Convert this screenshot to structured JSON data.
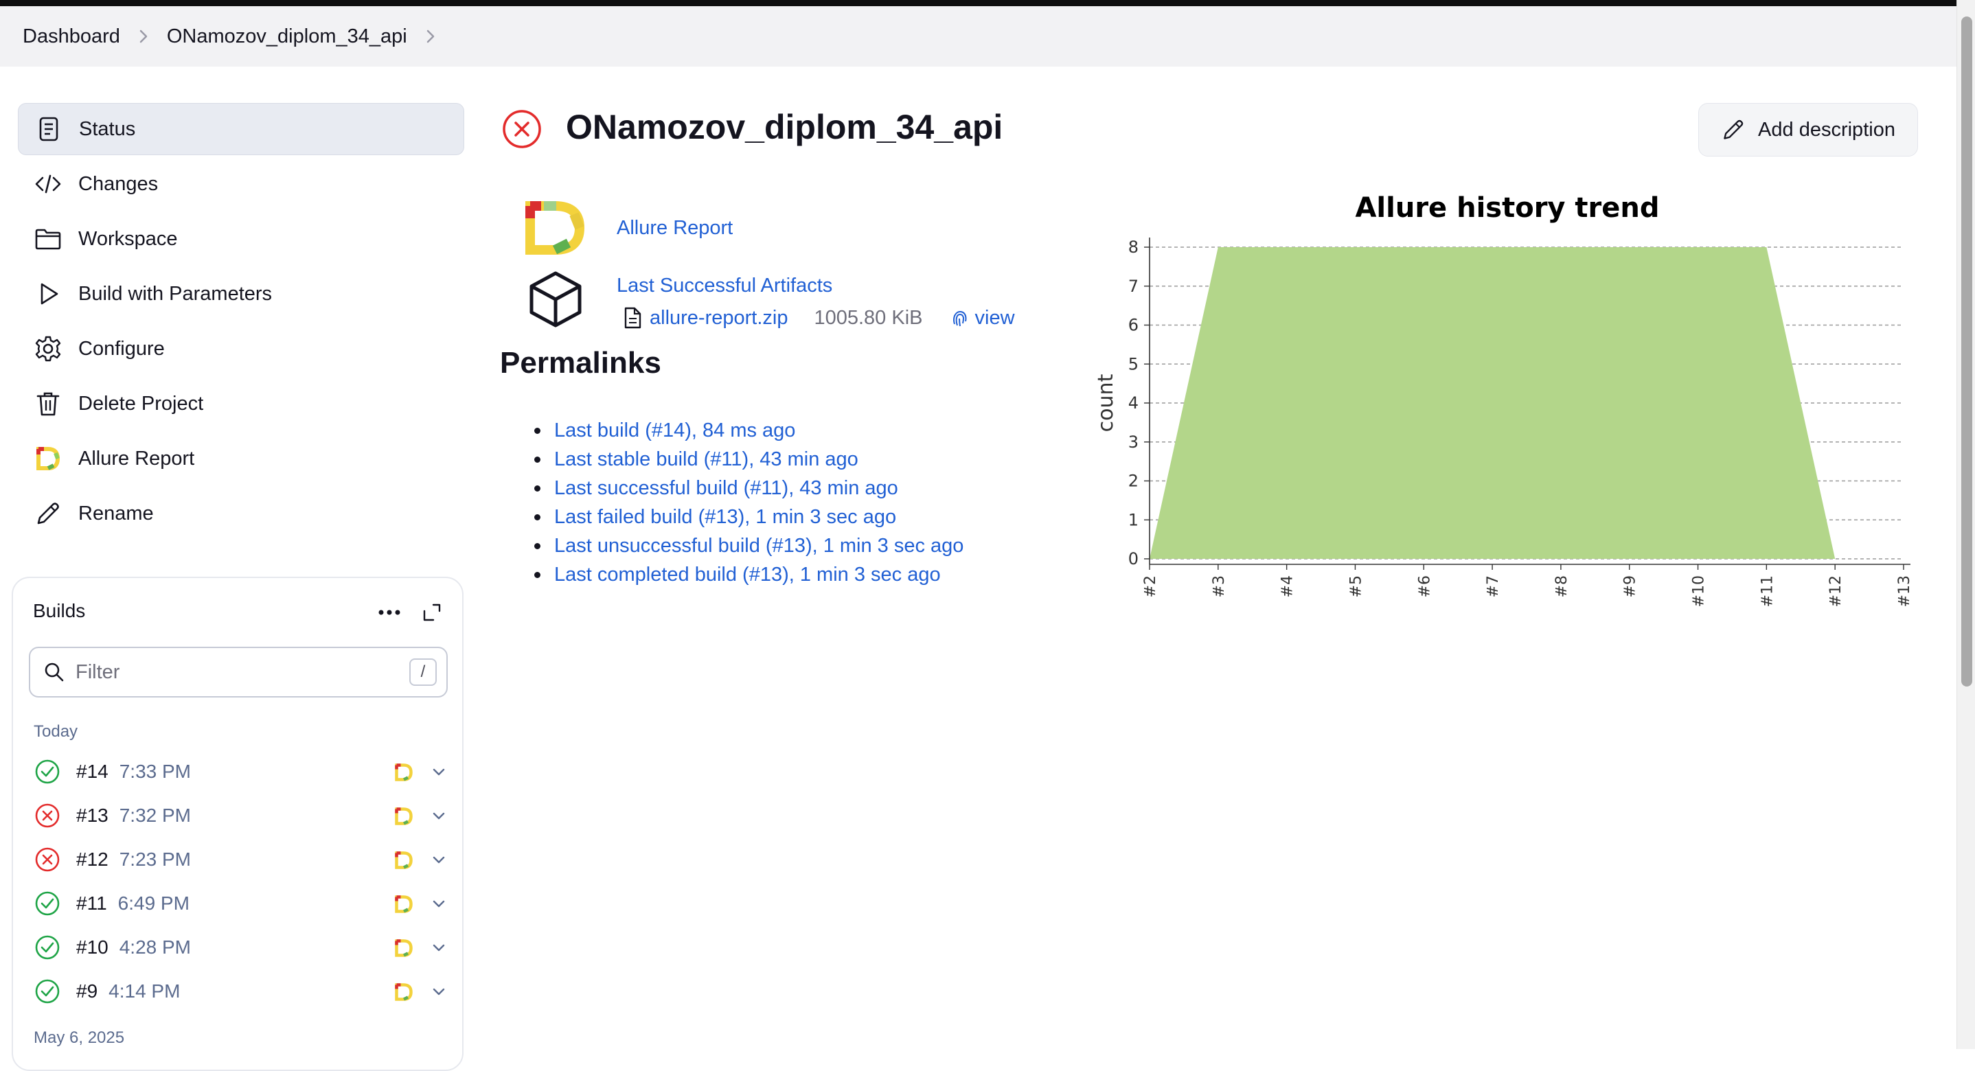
{
  "breadcrumb": {
    "items": [
      "Dashboard",
      "ONamozov_diplom_34_api"
    ]
  },
  "sidebar": {
    "items": [
      {
        "label": "Status",
        "icon": "document-icon",
        "active": true
      },
      {
        "label": "Changes",
        "icon": "code-icon"
      },
      {
        "label": "Workspace",
        "icon": "folder-icon"
      },
      {
        "label": "Build with Parameters",
        "icon": "play-icon"
      },
      {
        "label": "Configure",
        "icon": "gear-icon"
      },
      {
        "label": "Delete Project",
        "icon": "trash-icon"
      },
      {
        "label": "Allure Report",
        "icon": "allure-icon"
      },
      {
        "label": "Rename",
        "icon": "pencil-icon"
      }
    ]
  },
  "builds": {
    "title": "Builds",
    "filter_placeholder": "Filter",
    "filter_shortcut": "/",
    "groups": [
      {
        "label": "Today",
        "rows": [
          {
            "number": "#14",
            "time": "7:33 PM",
            "status": "success"
          },
          {
            "number": "#13",
            "time": "7:32 PM",
            "status": "failed"
          },
          {
            "number": "#12",
            "time": "7:23 PM",
            "status": "failed"
          },
          {
            "number": "#11",
            "time": "6:49 PM",
            "status": "success"
          },
          {
            "number": "#10",
            "time": "4:28 PM",
            "status": "success"
          },
          {
            "number": "#9",
            "time": "4:14 PM",
            "status": "success"
          }
        ]
      },
      {
        "label": "May 6, 2025",
        "rows": []
      }
    ]
  },
  "main": {
    "title": "ONamozov_diplom_34_api",
    "status": "failed",
    "add_description_label": "Add description",
    "allure_link": "Allure Report",
    "artifacts": {
      "label": "Last Successful Artifacts",
      "file_name": "allure-report.zip",
      "file_size": "1005.80 KiB",
      "view_label": "view"
    },
    "permalinks": {
      "heading": "Permalinks",
      "items": [
        "Last build (#14), 84 ms ago",
        "Last stable build (#11), 43 min ago",
        "Last successful build (#11), 43 min ago",
        "Last failed build (#13), 1 min 3 sec ago",
        "Last unsuccessful build (#13), 1 min 3 sec ago",
        "Last completed build (#13), 1 min 3 sec ago"
      ]
    }
  },
  "colors": {
    "link": "#2160d4",
    "area_fill": "#b3d68a",
    "success": "#1ea446",
    "failed": "#e32b2b"
  },
  "chart_data": {
    "type": "area",
    "title": "Allure history trend",
    "xlabel": "",
    "ylabel": "count",
    "x": [
      "#2",
      "#3",
      "#4",
      "#5",
      "#6",
      "#7",
      "#8",
      "#9",
      "#10",
      "#11",
      "#12",
      "#13"
    ],
    "series": [
      {
        "values": [
          0,
          8,
          8,
          8,
          8,
          8,
          8,
          8,
          8,
          8,
          0,
          null
        ]
      }
    ],
    "ylim": [
      0,
      8
    ],
    "yticks": [
      0,
      1,
      2,
      3,
      4,
      5,
      6,
      7,
      8
    ],
    "grid": true,
    "legend": "none"
  }
}
